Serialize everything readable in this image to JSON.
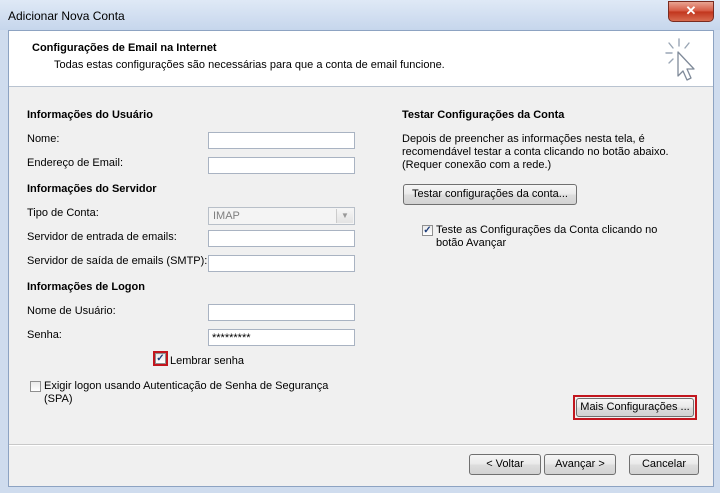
{
  "window": {
    "title": "Adicionar Nova Conta",
    "close_glyph": "✕"
  },
  "header": {
    "title": "Configurações de Email na Internet",
    "subtitle": "Todas estas configurações são necessárias para que a conta de email funcione."
  },
  "user_info": {
    "heading": "Informações do Usuário",
    "name_label": "Nome:",
    "name_value": "",
    "email_label": "Endereço de Email:",
    "email_value": ""
  },
  "server_info": {
    "heading": "Informações do Servidor",
    "account_type_label": "Tipo de Conta:",
    "account_type_value": "IMAP",
    "incoming_label": "Servidor de entrada de emails:",
    "incoming_value": "",
    "outgoing_label": "Servidor de saída de emails (SMTP):",
    "outgoing_value": ""
  },
  "logon_info": {
    "heading": "Informações de Logon",
    "username_label": "Nome de Usuário:",
    "username_value": "",
    "password_label": "Senha:",
    "password_value": "*********",
    "remember_label": "Lembrar senha",
    "remember_checked": true,
    "spa_label_line1": "Exigir logon usando Autenticação de Senha de Segurança",
    "spa_label_line2": "(SPA)",
    "spa_checked": false
  },
  "test_settings": {
    "heading": "Testar Configurações da Conta",
    "description_line1": "Depois de preencher as informações nesta tela, é",
    "description_line2": "recomendável testar a conta clicando no botão abaixo.",
    "description_line3": "(Requer conexão com a rede.)",
    "test_button": "Testar configurações da conta...",
    "auto_test_label_line1": "Teste as Configurações da Conta clicando no",
    "auto_test_label_line2": "botão Avançar",
    "auto_test_checked": true,
    "more_settings_button": "Mais Configurações ..."
  },
  "footer": {
    "back_button": "< Voltar",
    "next_button": "Avançar >",
    "cancel_button": "Cancelar"
  },
  "icons": {
    "check": "✓",
    "dropdown": "▼"
  },
  "colors": {
    "highlight_box": "#c2161e",
    "close_button": "#c1341c"
  }
}
